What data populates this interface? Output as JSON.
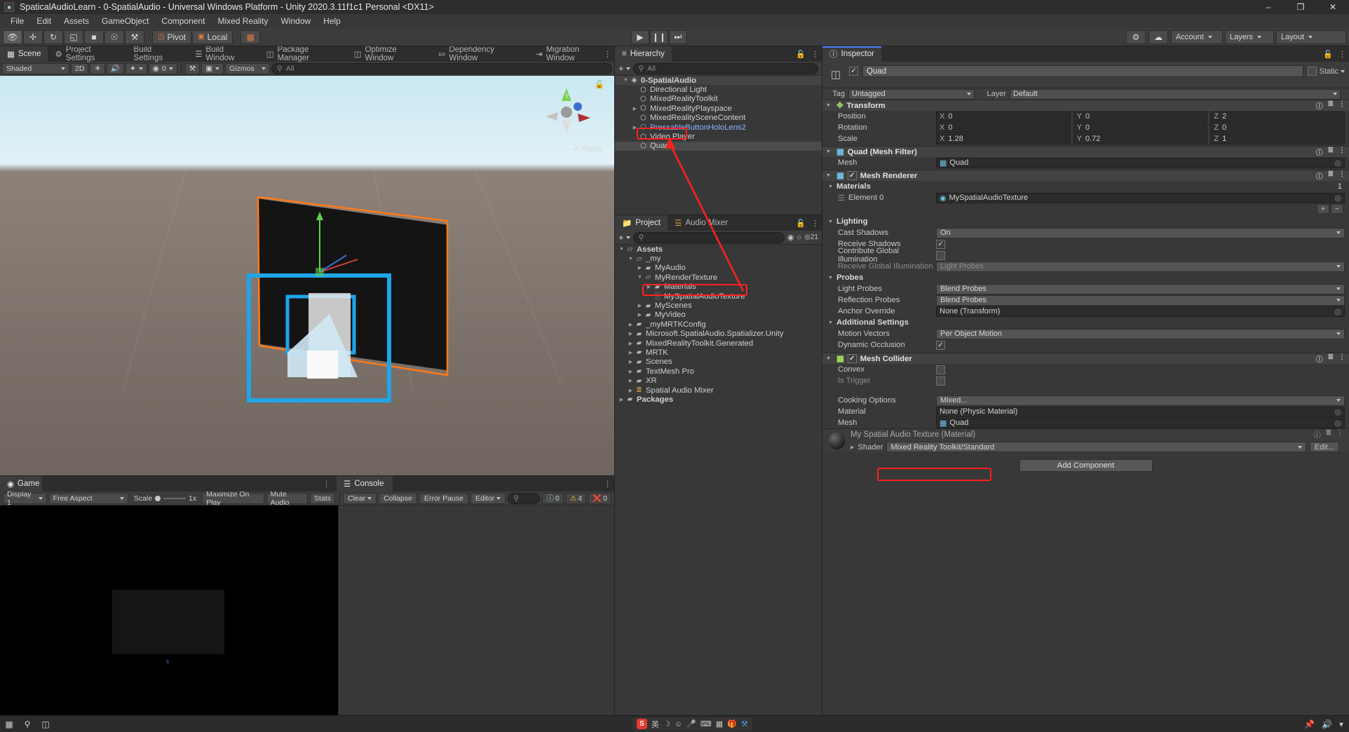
{
  "window": {
    "title": "SpaticalAudioLearn - 0-SpatialAudio - Universal Windows Platform - Unity 2020.3.11f1c1 Personal <DX11>",
    "minimize": "–",
    "maximize": "❐",
    "close": "✕",
    "app_icon": "unity-icon"
  },
  "menu": [
    "File",
    "Edit",
    "Assets",
    "GameObject",
    "Component",
    "Mixed Reality",
    "Window",
    "Help"
  ],
  "toolbar": {
    "tools": [
      "hand-tool",
      "move-tool",
      "rotate-tool",
      "scale-tool",
      "rect-tool",
      "transform-tool",
      "custom-tool"
    ],
    "pivot_label": "Pivot",
    "local_label": "Local",
    "grid_label": "grid-snap",
    "play": "▶",
    "pause": "❙❙",
    "step": "⏭",
    "collab_label": "collab-icon",
    "cloud_label": "cloud-icon",
    "account_label": "Account",
    "layers_label": "Layers",
    "layout_label": "Layout"
  },
  "left_tabs": [
    {
      "label": "Scene",
      "icon": "grid-icon",
      "active": true
    },
    {
      "label": "Project Settings",
      "icon": "gear-icon",
      "active": false
    },
    {
      "label": "Build Settings",
      "icon": "",
      "active": false
    },
    {
      "label": "Build Window",
      "icon": "layers-icon",
      "active": false
    },
    {
      "label": "Package Manager",
      "icon": "box-icon",
      "active": false
    },
    {
      "label": "Optimize Window",
      "icon": "cube-icon",
      "active": false
    },
    {
      "label": "Dependency Window",
      "icon": "link-icon",
      "active": false
    },
    {
      "label": "Migration Window",
      "icon": "arrow-icon",
      "active": false
    }
  ],
  "scene_toolbar": {
    "shading": "Shaded",
    "mode_2d": "2D",
    "light_icon": "light-bulb-icon",
    "audio_icon": "audio-icon",
    "fx_icon": "fx-icon",
    "cam_label": "0",
    "gizmos": "Gizmos",
    "search_placeholder": "All",
    "persp_label": "Persp",
    "gizmo_axes": [
      "y",
      "z",
      "x"
    ]
  },
  "game_tab": {
    "label": "Game",
    "icon": "gamepad-icon"
  },
  "game_toolbar": {
    "display": "Display 1",
    "aspect": "Free Aspect",
    "scale_label": "Scale",
    "scale_value": "1x",
    "maximize": "Maximize On Play",
    "mute": "Mute Audio",
    "stats": "Stats"
  },
  "console": {
    "tab_label": "Console",
    "clear": "Clear",
    "collapse": "Collapse",
    "error_pause": "Error Pause",
    "editor": "Editor",
    "search_placeholder": "",
    "log_count": "0",
    "warn_count": "4",
    "error_count": "0"
  },
  "hierarchy": {
    "tab_label": "Hierarchy",
    "add_label": "+",
    "search_placeholder": "All",
    "items": [
      {
        "label": "0-SpatialAudio",
        "depth": 0,
        "expanded": true,
        "icon": "scene-icon",
        "bold": true
      },
      {
        "label": "Directional Light",
        "depth": 1,
        "icon": "gameobject-icon"
      },
      {
        "label": "MixedRealityToolkit",
        "depth": 1,
        "icon": "gameobject-icon"
      },
      {
        "label": "MixedRealityPlayspace",
        "depth": 1,
        "icon": "gameobject-icon",
        "arrow": true
      },
      {
        "label": "MixedRealitySceneContent",
        "depth": 1,
        "icon": "gameobject-icon"
      },
      {
        "label": "PressableButtonHoloLens2",
        "depth": 1,
        "icon": "prefab-icon",
        "arrow": true,
        "prefab": true
      },
      {
        "label": "Video Player",
        "depth": 1,
        "icon": "gameobject-icon"
      },
      {
        "label": "Quad",
        "depth": 1,
        "icon": "gameobject-icon",
        "selected": true,
        "annotated": true
      }
    ]
  },
  "project": {
    "tab_label": "Project",
    "tab2_label": "Audio Mixer",
    "search_placeholder": "",
    "count_badge": "21",
    "items": [
      {
        "label": "Assets",
        "depth": 0,
        "expanded": true,
        "icon": "folder-open-icon",
        "bold": true
      },
      {
        "label": "_my",
        "depth": 1,
        "expanded": true,
        "icon": "folder-open-icon"
      },
      {
        "label": "MyAudio",
        "depth": 2,
        "arrow": true,
        "icon": "folder-icon"
      },
      {
        "label": "MyRenderTexture",
        "depth": 2,
        "expanded": true,
        "icon": "folder-open-icon"
      },
      {
        "label": "Materials",
        "depth": 3,
        "arrow": true,
        "icon": "folder-icon"
      },
      {
        "label": "MySpatialAudioTexture",
        "depth": 3,
        "icon": "rendertexture-icon",
        "annotated": true
      },
      {
        "label": "MyScenes",
        "depth": 2,
        "arrow": true,
        "icon": "folder-icon"
      },
      {
        "label": "MyVideo",
        "depth": 2,
        "arrow": true,
        "icon": "folder-icon"
      },
      {
        "label": "_myMRTKConfig",
        "depth": 1,
        "arrow": true,
        "icon": "folder-icon"
      },
      {
        "label": "Microsoft.SpatialAudio.Spatializer.Unity",
        "depth": 1,
        "arrow": true,
        "icon": "folder-icon"
      },
      {
        "label": "MixedRealityToolkit.Generated",
        "depth": 1,
        "arrow": true,
        "icon": "folder-icon"
      },
      {
        "label": "MRTK",
        "depth": 1,
        "arrow": true,
        "icon": "folder-icon"
      },
      {
        "label": "Scenes",
        "depth": 1,
        "arrow": true,
        "icon": "folder-icon"
      },
      {
        "label": "TextMesh Pro",
        "depth": 1,
        "arrow": true,
        "icon": "folder-icon"
      },
      {
        "label": "XR",
        "depth": 1,
        "arrow": true,
        "icon": "folder-icon"
      },
      {
        "label": "Spatial Audio Mixer",
        "depth": 1,
        "arrow": true,
        "icon": "mixer-icon"
      },
      {
        "label": "Packages",
        "depth": 0,
        "arrow": true,
        "icon": "folder-icon",
        "bold": true
      }
    ]
  },
  "inspector": {
    "tab_label": "Inspector",
    "object_name": "Quad",
    "enabled": true,
    "static_label": "Static",
    "tag_label": "Tag",
    "tag_value": "Untagged",
    "layer_label": "Layer",
    "layer_value": "Default",
    "transform": {
      "title": "Transform",
      "position_label": "Position",
      "position": {
        "x": "0",
        "y": "0",
        "z": "2"
      },
      "rotation_label": "Rotation",
      "rotation": {
        "x": "0",
        "y": "0",
        "z": "0"
      },
      "scale_label": "Scale",
      "scale": {
        "x": "1.28",
        "y": "0.72",
        "z": "1"
      }
    },
    "mesh_filter": {
      "title": "Quad (Mesh Filter)",
      "mesh_label": "Mesh",
      "mesh_value": "Quad"
    },
    "mesh_renderer": {
      "title": "Mesh Renderer",
      "enabled": true,
      "materials_label": "Materials",
      "materials_count": "1",
      "element_label": "Element 0",
      "element_value": "MySpatialAudioTexture",
      "lighting_label": "Lighting",
      "cast_shadows_label": "Cast Shadows",
      "cast_shadows_value": "On",
      "receive_shadows_label": "Receive Shadows",
      "receive_shadows_value": true,
      "contribute_gi_label": "Contribute Global Illumination",
      "contribute_gi_value": false,
      "receive_gi_label": "Receive Global Illumination",
      "receive_gi_value": "Light Probes",
      "probes_label": "Probes",
      "light_probes_label": "Light Probes",
      "light_probes_value": "Blend Probes",
      "reflection_probes_label": "Reflection Probes",
      "reflection_probes_value": "Blend Probes",
      "anchor_override_label": "Anchor Override",
      "anchor_override_value": "None (Transform)",
      "additional_label": "Additional Settings",
      "motion_vectors_label": "Motion Vectors",
      "motion_vectors_value": "Per Object Motion",
      "dynamic_occlusion_label": "Dynamic Occlusion",
      "dynamic_occlusion_value": true
    },
    "mesh_collider": {
      "title": "Mesh Collider",
      "enabled": true,
      "convex_label": "Convex",
      "convex_value": false,
      "is_trigger_label": "Is Trigger",
      "is_trigger_value": false,
      "cooking_label": "Cooking Options",
      "cooking_value": "Mixed...",
      "material_label": "Material",
      "material_value": "None (Physic Material)",
      "mesh_label": "Mesh",
      "mesh_value": "Quad"
    },
    "material": {
      "title": "My Spatial Audio Texture (Material)",
      "shader_label": "Shader",
      "shader_value": "Mixed Reality Toolkit/Standard",
      "edit_label": "Edit..."
    },
    "add_component": "Add Component"
  },
  "taskbar": {
    "start_icon": "windows-icon",
    "search_icon": "search-icon",
    "task_icon": "taskview-icon",
    "ime_label": "英",
    "ime_items": [
      "moon-icon",
      "smile-icon",
      "mic-icon",
      "keyboard-icon",
      "grid-icon",
      "gift-icon",
      "tool-icon"
    ],
    "tray": [
      "pin-icon",
      "volume-icon",
      "network-icon"
    ]
  },
  "colors": {
    "accent": "#4c7eff",
    "annotation": "#ff2020",
    "selection_outline": "#ff7a18",
    "handle_blue": "#1fa5e8"
  }
}
